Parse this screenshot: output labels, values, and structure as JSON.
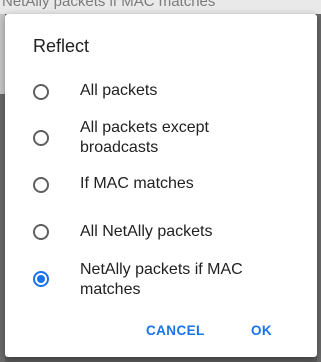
{
  "background": {
    "partial_text": "NetAlly packets if MAC matches"
  },
  "dialog": {
    "title": "Reflect",
    "options": [
      {
        "label": "All packets",
        "selected": false
      },
      {
        "label": "All packets except broadcasts",
        "selected": false
      },
      {
        "label": "If MAC matches",
        "selected": false
      },
      {
        "label": "All NetAlly packets",
        "selected": false
      },
      {
        "label": "NetAlly packets if MAC matches",
        "selected": true
      }
    ],
    "cancel_label": "CANCEL",
    "ok_label": "OK"
  },
  "colors": {
    "accent": "#1a73e8",
    "radio_unselected": "#5f5f5f",
    "scrim": "#5a5a5a"
  }
}
